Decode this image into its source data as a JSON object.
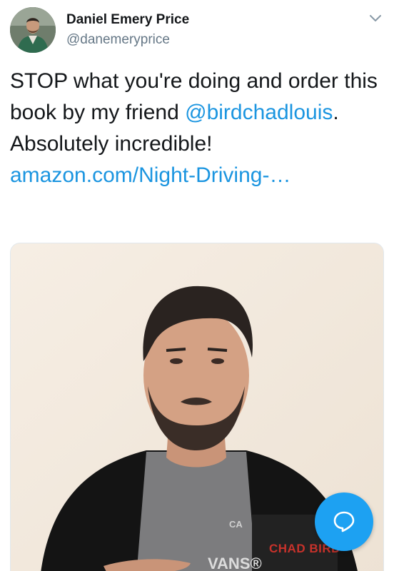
{
  "author": {
    "name": "Daniel Emery Price",
    "handle": "@danemeryprice"
  },
  "tweet": {
    "text_before": "STOP what you're doing and order this book by my friend ",
    "mention": "@birdchadlouis",
    "text_after": ". Absolutely incredible!",
    "link": "amazon.com/Night-Driving-…"
  },
  "media": {
    "book_title": "CHAD BIRD",
    "shirt_brand": "VANS®",
    "shirt_top": "CA"
  },
  "icons": {
    "menu": "chevron-down-icon",
    "compose": "reply-bubble-icon"
  },
  "colors": {
    "link": "#1b95e0",
    "fab": "#1da1f2",
    "handle": "#657786"
  }
}
